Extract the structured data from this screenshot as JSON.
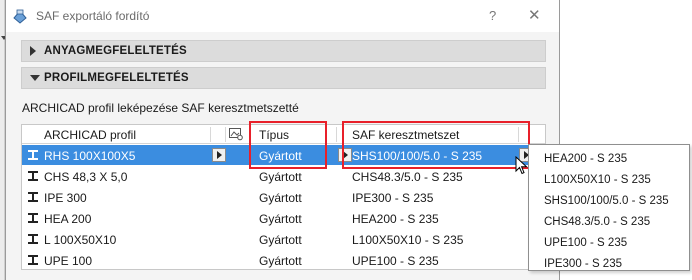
{
  "window": {
    "title": "SAF exportáló fordító",
    "help_glyph": "?",
    "close_glyph": "✕"
  },
  "sections": {
    "material": {
      "label": "ANYAGMEGFELELTETÉS",
      "expanded": false
    },
    "profile": {
      "label": "PROFILMEGFELELTETÉS",
      "expanded": true
    }
  },
  "profile_mapping": {
    "description": "ARCHICAD profil leképezése SAF keresztmetszetté",
    "columns": {
      "archicad": "ARCHICAD profil",
      "type": "Típus",
      "saf": "SAF keresztmetszet"
    },
    "rows": [
      {
        "profile": "RHS 100X100X5",
        "type": "Gyártott",
        "saf": "SHS100/100/5.0 - S 235",
        "selected": true
      },
      {
        "profile": "CHS 48,3 X 5,0",
        "type": "Gyártott",
        "saf": "CHS48.3/5.0 - S 235",
        "selected": false
      },
      {
        "profile": "IPE 300",
        "type": "Gyártott",
        "saf": "IPE300 - S 235",
        "selected": false
      },
      {
        "profile": "HEA 200",
        "type": "Gyártott",
        "saf": "HEA200 - S 235",
        "selected": false
      },
      {
        "profile": "L 100X50X10",
        "type": "Gyártott",
        "saf": "L100X50X10 - S 235",
        "selected": false
      },
      {
        "profile": "UPE 100",
        "type": "Gyártott",
        "saf": "UPE100 - S 235",
        "selected": false
      }
    ]
  },
  "dropdown_menu": {
    "items": [
      "HEA200 - S 235",
      "L100X50X10 - S 235",
      "SHS100/100/5.0 - S 235",
      "CHS48.3/5.0 - S 235",
      "UPE100 - S 235",
      "IPE300 - S 235"
    ]
  },
  "icons": {
    "app": "saf-app-icon",
    "row": "i-beam-profile-icon",
    "header": "gear-icon",
    "cursor": "mouse-pointer-icon"
  },
  "colors": {
    "selection": "#3b8de0",
    "highlight_box": "#e8202a",
    "section_bg": "#dcdcdc"
  }
}
